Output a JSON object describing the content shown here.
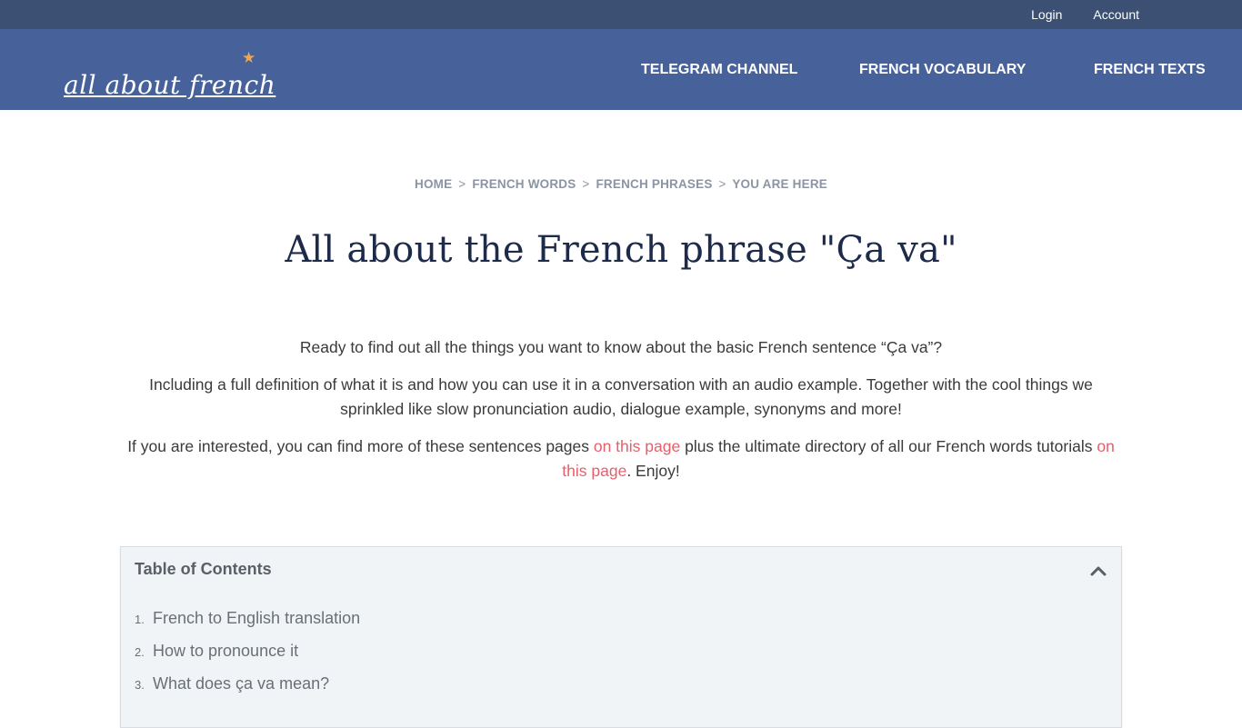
{
  "topbar": {
    "links": [
      {
        "label": "Login"
      },
      {
        "label": "Account"
      }
    ]
  },
  "header": {
    "logo_text": "all about french",
    "logo_star": "★",
    "nav": [
      {
        "label": "TELEGRAM CHANNEL"
      },
      {
        "label": "FRENCH VOCABULARY"
      },
      {
        "label": "FRENCH TEXTS"
      }
    ],
    "colors": {
      "topbar_bg": "#3b5072",
      "nav_bg": "#47629a",
      "star": "#f0a64e"
    }
  },
  "breadcrumb": {
    "items": [
      {
        "label": "HOME"
      },
      {
        "label": "FRENCH WORDS"
      },
      {
        "label": "FRENCH PHRASES"
      },
      {
        "label": "YOU ARE HERE"
      }
    ],
    "separator": ">"
  },
  "page": {
    "title": "All about the French phrase \"Ça va\"",
    "intro": {
      "p1": "Ready to find out all the things you want to know about the basic French sentence “Ça va”?",
      "p2": "Including a full definition of what it is and how you can use it in a conversation with an audio example. Together with the cool things we sprinkled like slow pronunciation audio, dialogue example, synonyms and more!",
      "p3_part1": "If you are interested, you can find more of these sentences pages ",
      "p3_link1": "on this page",
      "p3_part2": " plus the ultimate directory of all our French words tutorials ",
      "p3_link2": "on this page",
      "p3_part3": ". Enjoy!"
    },
    "link_color": "#e5606b"
  },
  "toc": {
    "title": "Table of Contents",
    "toggle_icon": "chevron-up",
    "items": [
      {
        "num": "1.",
        "label": "French to English translation"
      },
      {
        "num": "2.",
        "label": "How to pronounce it"
      },
      {
        "num": "3.",
        "label": "What does ça va mean?"
      }
    ]
  }
}
